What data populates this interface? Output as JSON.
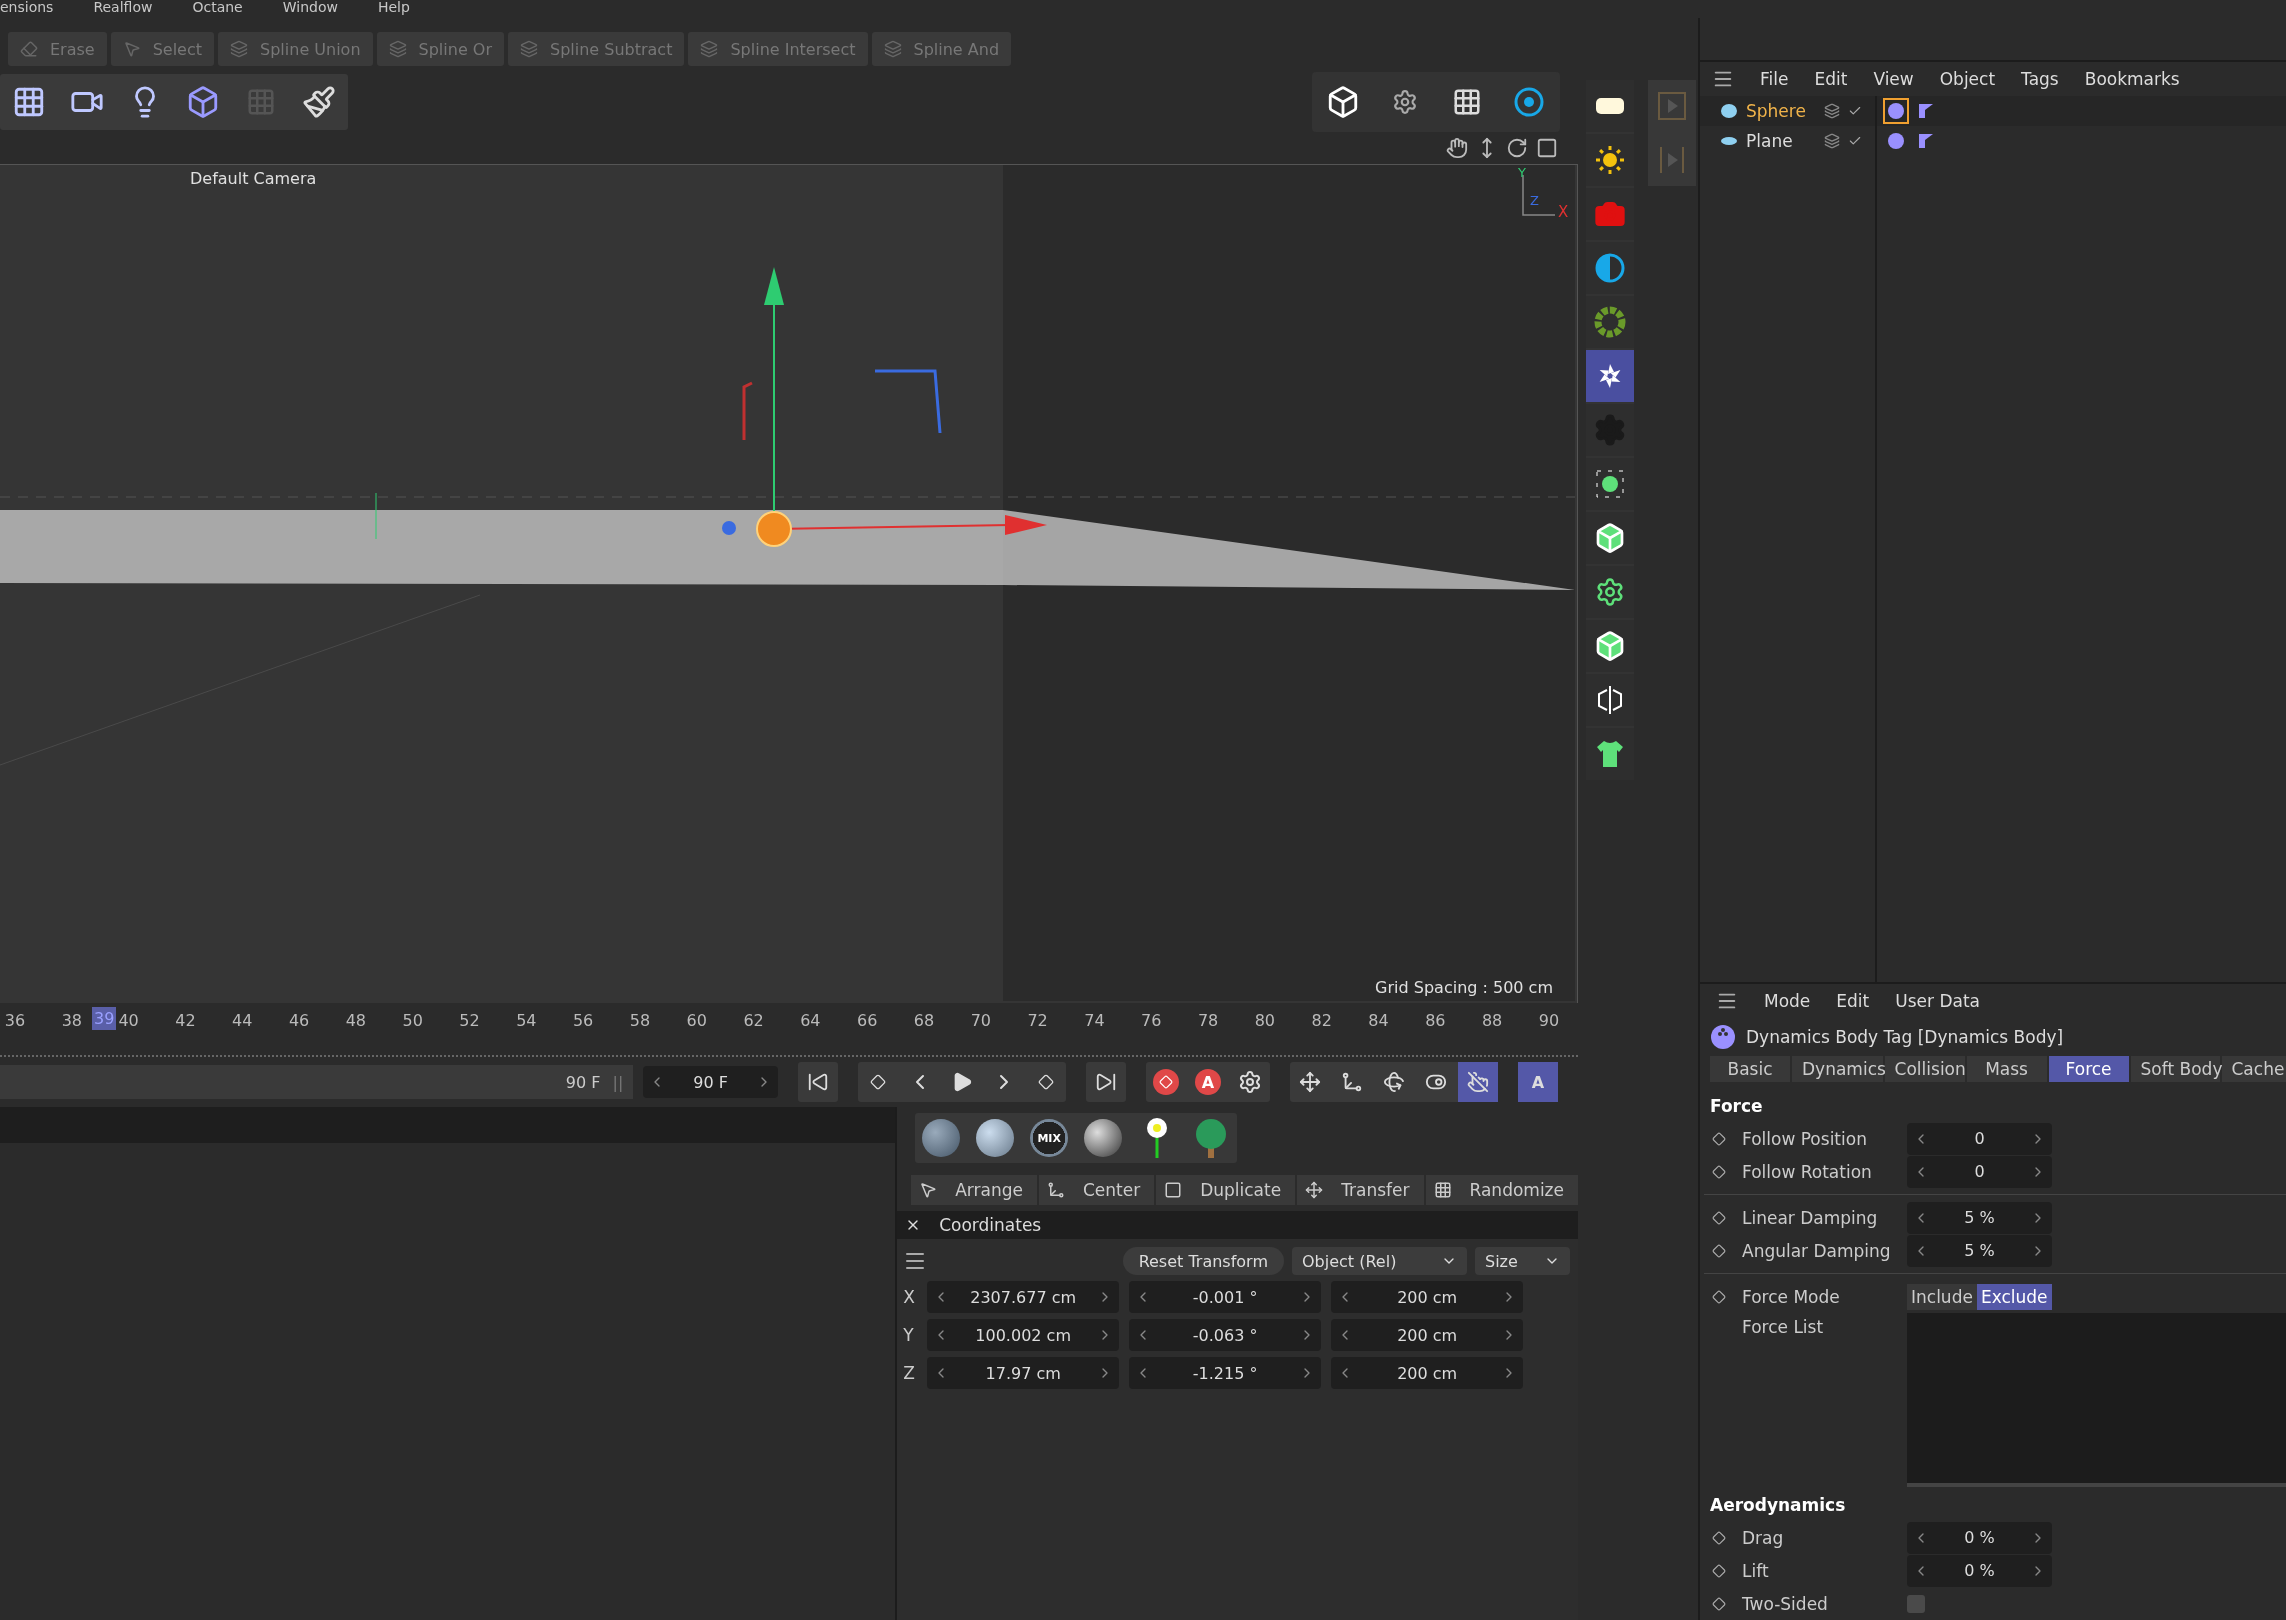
{
  "menu_bar": [
    "ensions",
    "Realflow",
    "Octane",
    "Window",
    "Help"
  ],
  "spline_toolbar": [
    {
      "label": "Erase",
      "disabled": true
    },
    {
      "label": "Select",
      "disabled": true
    },
    {
      "label": "Spline Union",
      "disabled": true
    },
    {
      "label": "Spline Or",
      "disabled": true
    },
    {
      "label": "Spline Subtract",
      "disabled": true
    },
    {
      "label": "Spline Intersect",
      "disabled": true
    },
    {
      "label": "Spline And",
      "disabled": true
    }
  ],
  "viewport": {
    "camera_label": "Default Camera",
    "grid_spacing": "Grid Spacing : 500 cm",
    "axis_labels": [
      "Y",
      "Z",
      "X"
    ]
  },
  "palette": [
    {
      "selected": false
    },
    {
      "selected": false
    },
    {
      "selected": false
    },
    {
      "selected": false
    },
    {
      "selected": false
    },
    {
      "selected": true
    },
    {
      "selected": false
    },
    {
      "selected": false
    },
    {
      "selected": false
    },
    {
      "selected": false
    },
    {
      "selected": false
    },
    {
      "selected": false
    },
    {
      "selected": false
    }
  ],
  "object_manager": {
    "menu": [
      "File",
      "Edit",
      "View",
      "Object",
      "Tags",
      "Bookmarks"
    ],
    "objects": [
      {
        "name": "Sphere",
        "selected": true
      },
      {
        "name": "Plane",
        "selected": false
      }
    ]
  },
  "timeline": {
    "ticks": [
      "36",
      "38",
      "40",
      "42",
      "44",
      "46",
      "48",
      "50",
      "52",
      "54",
      "56",
      "58",
      "60",
      "62",
      "64",
      "66",
      "68",
      "70",
      "72",
      "74",
      "76",
      "78",
      "80",
      "82",
      "84",
      "86",
      "88",
      "90"
    ],
    "current_frame": "39",
    "end_field": "90 F",
    "end_field_handle": "||",
    "end_frame": "90 F",
    "autokey_label": "A",
    "keymode_label": "A"
  },
  "materials": {
    "mix_label": "MIX"
  },
  "layout_tools": [
    "Arrange",
    "Center",
    "Duplicate",
    "Transfer",
    "Randomize"
  ],
  "coordinates": {
    "title": "Coordinates",
    "reset": "Reset Transform",
    "mode": "Object (Rel)",
    "size_mode": "Size",
    "rows": [
      {
        "axis": "X",
        "position": "2307.677 cm",
        "rotation": "-0.001 °",
        "size": "200 cm"
      },
      {
        "axis": "Y",
        "position": "100.002 cm",
        "rotation": "-0.063 °",
        "size": "200 cm"
      },
      {
        "axis": "Z",
        "position": "17.97 cm",
        "rotation": "-1.215 °",
        "size": "200 cm"
      }
    ]
  },
  "attributes": {
    "menu": [
      "Mode",
      "Edit",
      "User Data"
    ],
    "title": "Dynamics Body Tag [Dynamics Body]",
    "tabs": [
      {
        "label": "Basic",
        "selected": false
      },
      {
        "label": "Dynamics",
        "selected": false
      },
      {
        "label": "Collision",
        "selected": false
      },
      {
        "label": "Mass",
        "selected": false
      },
      {
        "label": "Force",
        "selected": true
      },
      {
        "label": "Soft Body",
        "selected": false
      },
      {
        "label": "Cache",
        "selected": false
      }
    ],
    "fields": [
      {
        "kind": "heading",
        "label": "Force"
      },
      {
        "kind": "number",
        "label": "Follow Position",
        "value": "0"
      },
      {
        "kind": "number",
        "label": "Follow Rotation",
        "value": "0"
      },
      {
        "kind": "divider"
      },
      {
        "kind": "number",
        "label": "Linear Damping",
        "value": "5 %"
      },
      {
        "kind": "number",
        "label": "Angular Damping",
        "value": "5 %"
      },
      {
        "kind": "divider"
      },
      {
        "kind": "mode",
        "label": "Force Mode",
        "options": [
          {
            "label": "Include",
            "selected": false
          },
          {
            "label": "Exclude",
            "selected": true
          }
        ]
      },
      {
        "kind": "list",
        "label": "Force List"
      },
      {
        "kind": "heading",
        "label": "Aerodynamics"
      },
      {
        "kind": "number",
        "label": "Drag",
        "value": "0 %"
      },
      {
        "kind": "number",
        "label": "Lift",
        "value": "0 %"
      },
      {
        "kind": "checkbox",
        "label": "Two-Sided",
        "checked": false
      }
    ]
  }
}
